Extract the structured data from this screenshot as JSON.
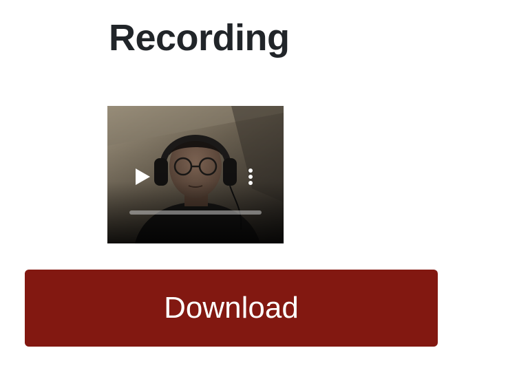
{
  "page": {
    "title": "Recording"
  },
  "video": {
    "play_icon": "play-icon",
    "menu_icon": "more-vertical-icon",
    "progress": 0
  },
  "actions": {
    "download_label": "Download"
  },
  "colors": {
    "title_text": "#212529",
    "download_background": "#821811",
    "download_text": "#ffffff"
  }
}
